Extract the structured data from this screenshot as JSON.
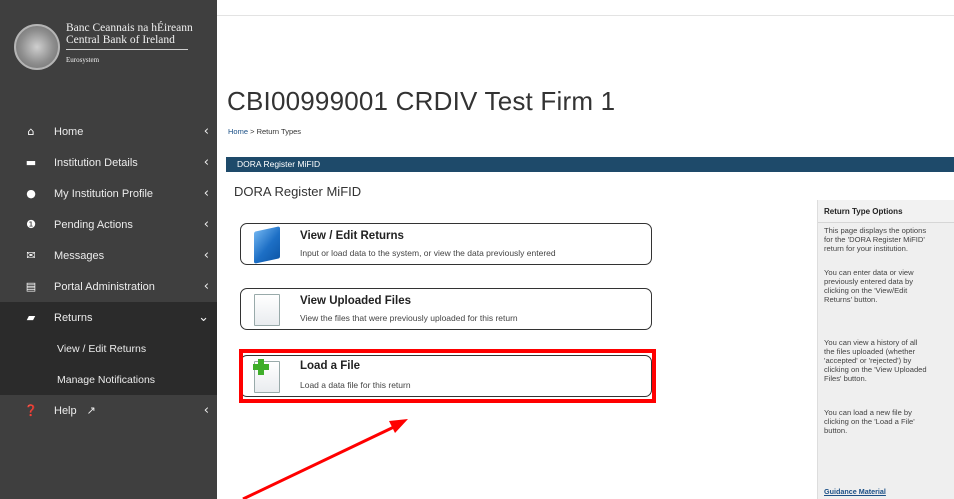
{
  "logo": {
    "line1": "Banc Ceannais na hÉireann",
    "line2": "Central Bank of Ireland",
    "line3": "Eurosystem"
  },
  "sidebar": {
    "items": [
      {
        "label": "Home",
        "icon": "home-icon"
      },
      {
        "label": "Institution Details",
        "icon": "bank-icon"
      },
      {
        "label": "My Institution Profile",
        "icon": "user-icon"
      },
      {
        "label": "Pending Actions",
        "icon": "alert-icon"
      },
      {
        "label": "Messages",
        "icon": "envelope-icon"
      },
      {
        "label": "Portal Administration",
        "icon": "list-icon"
      },
      {
        "label": "Returns",
        "icon": "folder-open-icon"
      }
    ],
    "returns_sub": [
      {
        "label": "View / Edit Returns"
      },
      {
        "label": "Manage Notifications"
      }
    ],
    "help": {
      "label": "Help",
      "icon": "help-icon",
      "ext_icon": "external-link-icon"
    }
  },
  "page": {
    "title": "CBI00999001 CRDIV Test Firm 1",
    "breadcrumb_home": "Home",
    "breadcrumb_sep": " > ",
    "breadcrumb_current": "Return Types",
    "section_bar": "DORA Register MiFID",
    "subtitle": "DORA Register MiFID"
  },
  "cards": [
    {
      "title": "View / Edit Returns",
      "desc": "Input or load data to the system, or view the data previously entered",
      "icon": "folder-icon"
    },
    {
      "title": "View Uploaded Files",
      "desc": "View the files that were previously uploaded for this return",
      "icon": "file-icon"
    },
    {
      "title": "Load a File",
      "desc": "Load a data file for this return",
      "icon": "file-add-icon"
    }
  ],
  "side_panel": {
    "heading": "Return Type Options",
    "p1": "This page displays the options\nfor the 'DORA Register MiFID'\nreturn for your institution.",
    "p2": "You can enter data or view\npreviously entered data by\nclicking on the 'View/Edit\nReturns' button.",
    "p3": "You can view a history of all\nthe files uploaded (whether\n'accepted' or 'rejected') by\nclicking on the 'View Uploaded\nFiles' button.",
    "p4": "You can load a new file by\nclicking on the 'Load a File'\nbutton.",
    "guidance": "Guidance Material"
  },
  "colors": {
    "sidebar_bg": "#3f3f3f",
    "section_bar": "#1e4a6a",
    "highlight": "#ff0000"
  }
}
